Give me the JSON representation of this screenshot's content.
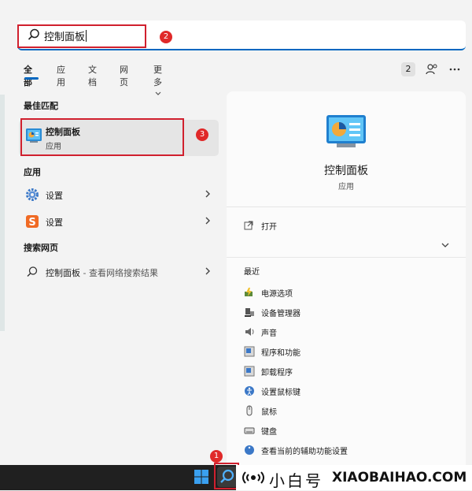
{
  "search": {
    "query": "控制面板"
  },
  "annotations": {
    "taskbar_badge": "1",
    "search_badge": "2",
    "best_badge": "3"
  },
  "tabs": {
    "items": [
      "全部",
      "应用",
      "文档",
      "网页",
      "更多"
    ],
    "result_count": "2"
  },
  "best_match": {
    "section_title": "最佳匹配",
    "title": "控制面板",
    "subtitle": "应用"
  },
  "apps": {
    "section_title": "应用",
    "items": [
      {
        "label": "设置",
        "icon": "gear-icon"
      },
      {
        "label": "设置",
        "icon": "sogou-s-icon"
      }
    ]
  },
  "web": {
    "section_title": "搜索网页",
    "item_label": "控制面板",
    "item_suffix": " - 查看网络搜索结果"
  },
  "detail": {
    "title": "控制面板",
    "subtitle": "应用",
    "open_label": "打开",
    "recent_title": "最近",
    "recent_items": [
      "电源选项",
      "设备管理器",
      "声音",
      "程序和功能",
      "卸载程序",
      "设置鼠标键",
      "鼠标",
      "键盘",
      "查看当前的辅助功能设置"
    ]
  },
  "watermark": {
    "cn": "小白号",
    "en": "XIAOBAIHAO.COM"
  },
  "colors": {
    "accent": "#0067c0",
    "highlight_box": "#d0202e",
    "taskbar": "#202020"
  }
}
